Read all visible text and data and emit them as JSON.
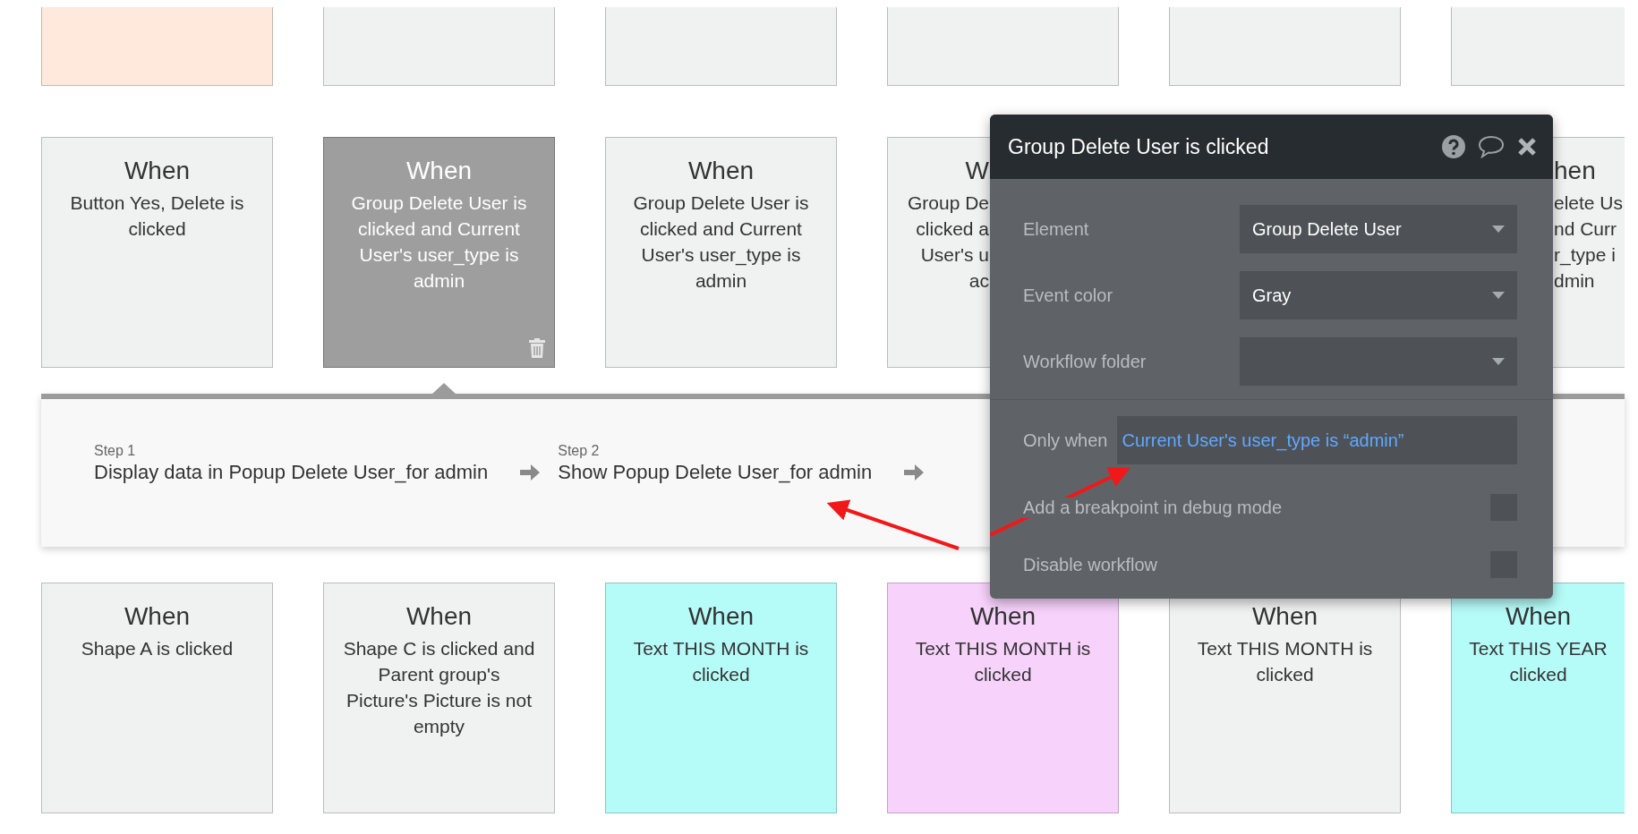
{
  "rows": [
    {
      "cards": [
        {
          "kind": "full",
          "color": "#ffe9dd",
          "selected": false
        },
        {
          "kind": "full",
          "color": "#f0f1f1",
          "selected": false
        },
        {
          "kind": "full",
          "color": "#f0f1f1",
          "selected": false
        },
        {
          "kind": "full",
          "color": "#f0f1f1",
          "selected": false
        },
        {
          "kind": "full",
          "color": "#f0f1f1",
          "selected": false
        },
        {
          "kind": "full",
          "color": "#f0f1f1",
          "selected": false
        }
      ]
    },
    {
      "cards": [
        {
          "kind": "full",
          "color": "#f0f1f1",
          "selected": false,
          "title": "When",
          "lines": [
            "Button Yes, Delete is",
            "clicked"
          ]
        },
        {
          "kind": "full",
          "color": "#9e9e9e",
          "selected": true,
          "title": "When",
          "lines": [
            "Group Delete User is",
            "clicked and Current",
            "User's user_type is",
            "admin"
          ]
        },
        {
          "kind": "full",
          "color": "#f0f1f1",
          "selected": false,
          "title": "When",
          "lines": [
            "Group Delete User is",
            "clicked and Current",
            "User's user_type is",
            "admin"
          ]
        },
        {
          "kind": "left-part",
          "color": "#f0f1f1",
          "selected": false,
          "title": "W",
          "lines": [
            "Group De",
            "clicked a",
            "User's u",
            "ac"
          ]
        },
        {
          "kind": "right-part",
          "color": "#f0f1f1",
          "selected": false,
          "title": "hen",
          "lines": [
            "elete Us",
            "nd Curr",
            "r_type i",
            "dmin"
          ]
        }
      ]
    },
    {
      "steps": [
        {
          "label": "Step 1",
          "action": "Display data in Popup Delete User_for admin"
        },
        {
          "label": "Step 2",
          "action": "Show Popup Delete User_for admin"
        }
      ]
    },
    {
      "cards": [
        {
          "kind": "full",
          "color": "#f0f1f1",
          "selected": false,
          "title": "When",
          "lines": [
            "Shape A is clicked"
          ]
        },
        {
          "kind": "full",
          "color": "#f0f1f1",
          "selected": false,
          "title": "When",
          "lines": [
            "Shape C is clicked and",
            "Parent group's",
            "Picture's Picture is not",
            "empty"
          ]
        },
        {
          "kind": "full",
          "color": "#b5fbf8",
          "selected": false,
          "title": "When",
          "lines": [
            "Text THIS MONTH is",
            "clicked"
          ]
        },
        {
          "kind": "full",
          "color": "#f7d2fb",
          "selected": false,
          "title": "When",
          "lines": [
            "Text THIS MONTH is",
            "clicked"
          ]
        },
        {
          "kind": "full",
          "color": "#f0f1f1",
          "selected": false,
          "title": "When",
          "lines": [
            "Text THIS MONTH is",
            "clicked"
          ]
        },
        {
          "kind": "full",
          "color": "#b5fbf8",
          "selected": false,
          "title": "When",
          "lines": [
            "Text THIS YEAR",
            "clicked"
          ]
        }
      ]
    }
  ],
  "popup": {
    "title": "Group Delete User is clicked",
    "fields": [
      {
        "label": "Element",
        "value": "Group Delete User"
      },
      {
        "label": "Event color",
        "value": "Gray"
      },
      {
        "label": "Workflow folder"
      }
    ],
    "condition": {
      "label": "Only when",
      "value": "Current User's user_type is “admin”"
    },
    "checkboxes": [
      {
        "label": "Add a breakpoint in debug mode",
        "checked": false
      },
      {
        "label": "Disable workflow",
        "checked": false
      }
    ]
  }
}
